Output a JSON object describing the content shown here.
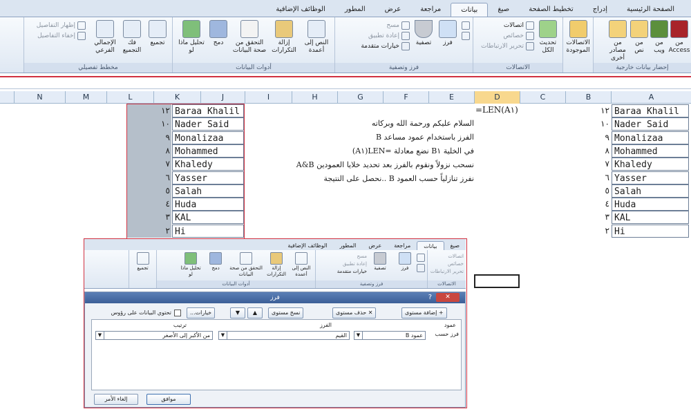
{
  "tabs": [
    "الصفحة الرئيسية",
    "إدراج",
    "تخطيط الصفحة",
    "صيغ",
    "بيانات",
    "مراجعة",
    "عرض",
    "المطور",
    "الوظائف الإضافية"
  ],
  "active_tab": "بيانات",
  "ribbon": {
    "external": {
      "label": "إحضار بيانات خارجية",
      "b1": "من Access",
      "b2": "من ويب",
      "b3": "من نص",
      "b4": "من مصادر أخرى",
      "b5": "الاتصالات الموجودة"
    },
    "connections": {
      "label": "الاتصالات",
      "refresh": "تحديث الكل",
      "conn": "اتصالات",
      "props": "خصائص",
      "edit": "تحرير الارتباطات"
    },
    "sort": {
      "label": "فرز وتصفية",
      "sort": "فرز",
      "filter": "تصفية",
      "clear": "مسح",
      "reapply": "إعادة تطبيق",
      "advanced": "خيارات متقدمة"
    },
    "tools": {
      "label": "أدوات البيانات",
      "text2col": "النص إلى أعمدة",
      "dup": "إزالة التكرارات",
      "validate": "التحقق من صحة البيانات",
      "merge": "دمج",
      "whatif": "تحليل ماذا لو"
    },
    "outline": {
      "label": "مخطط تفصيلي",
      "group": "تجميع",
      "ungroup": "فك التجميع",
      "subtotal": "الإجمالي الفرعي",
      "show": "إظهار التفاصيل",
      "hide": "إخفاء التفاصيل"
    }
  },
  "columns": [
    "N",
    "M",
    "L",
    "K",
    "J",
    "I",
    "H",
    "G",
    "F",
    "E",
    "D",
    "C",
    "B",
    "A"
  ],
  "names": [
    "Baraa Khalil",
    "Nader Said",
    "Monalizaa",
    "Mohammed",
    "Khaledy",
    "Yasser",
    "Salah",
    "Huda",
    "KAL",
    "Hi"
  ],
  "lengths": [
    "١٢",
    "١٠",
    "٩",
    "٨",
    "٧",
    "٦",
    "٥",
    "٤",
    "٣",
    "٢"
  ],
  "formula": "=LEN(A١)",
  "notes": [
    "السلام عليكم ورحمة الله وبركاته",
    "الفرز باستخدام عمود مساعد B",
    "في الخلية B١ نضع معادلة =LEN(A١)",
    "نسحب نزولاً ونقوم بالفرز بعد تحديد خلايا العمودين A&B",
    "نفرز تنازلياً حسب العمود B ..نحصل على النتيجة"
  ],
  "embedded_tabs": [
    "صيغ",
    "بيانات",
    "مراجعة",
    "عرض",
    "المطور",
    "الوظائف الإضافية"
  ],
  "dialog": {
    "title": "فرز",
    "help": "?",
    "close": "✕",
    "add_level": "إضافة مستوى",
    "delete_level": "حذف مستوى",
    "copy_level": "نسخ مستوى",
    "options": "خيارات...",
    "header_checkbox": "تحتوي البيانات على رؤوس",
    "col_header": "عمود",
    "sorton_header": "الفرز",
    "order_header": "ترتيب",
    "sort_by": "فرز حسب",
    "column_value": "عمود B",
    "sorton_value": "القيم",
    "order_value": "من الأكبر إلى الأصغر",
    "ok": "موافق",
    "cancel": "إلغاء الأمر"
  },
  "colors": {
    "accent": "#d03040",
    "selected_header": "#f8d88e",
    "ribbon": "#dfe8f3"
  }
}
